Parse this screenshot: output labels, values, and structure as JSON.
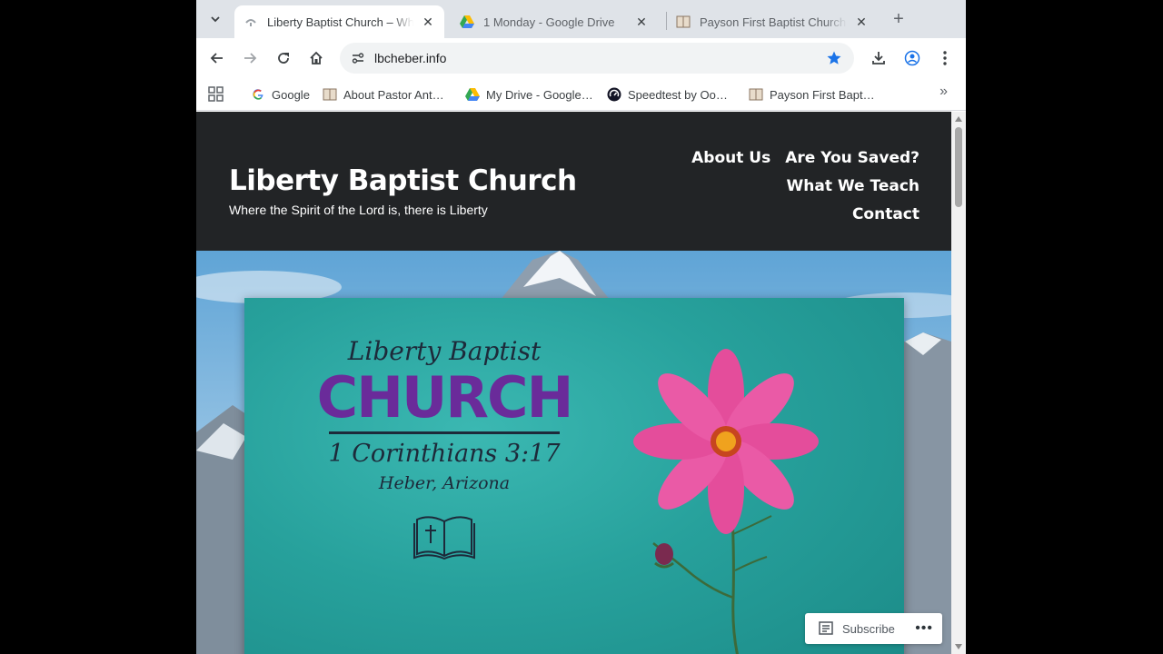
{
  "browser": {
    "tabs": [
      {
        "title": "Liberty Baptist Church – Wh",
        "active": true,
        "favicon": "church-icon"
      },
      {
        "title": "1 Monday - Google Drive",
        "active": false,
        "favicon": "google-drive-icon"
      },
      {
        "title": "Payson First Baptist Church",
        "active": false,
        "favicon": "book-icon"
      }
    ],
    "new_tab_label": "+",
    "url": "lbcheber.info",
    "bookmarks": [
      {
        "label": "Google",
        "icon": "google-icon"
      },
      {
        "label": "About Pastor Ant…",
        "icon": "book-icon"
      },
      {
        "label": "My Drive - Google…",
        "icon": "google-drive-icon"
      },
      {
        "label": "Speedtest by Oo…",
        "icon": "speedtest-icon"
      },
      {
        "label": "Payson First Bapt…",
        "icon": "book-icon"
      }
    ],
    "bookmarks_more": "»",
    "accent_color": "#1a73e8"
  },
  "site": {
    "title": "Liberty Baptist Church",
    "tagline": "Where the Spirit of the Lord is, there is Liberty",
    "nav": [
      "About Us",
      "Are You Saved?",
      "What We Teach",
      "Contact"
    ],
    "header_color": "#222426"
  },
  "hero": {
    "line1": "Liberty Baptist",
    "line2": "CHURCH",
    "verse": "1 Corinthians 3:17",
    "location": "Heber, Arizona",
    "card_color": "#27a19c",
    "church_color": "#6a2b9a"
  },
  "subscribe": {
    "label": "Subscribe",
    "more": "•••"
  }
}
